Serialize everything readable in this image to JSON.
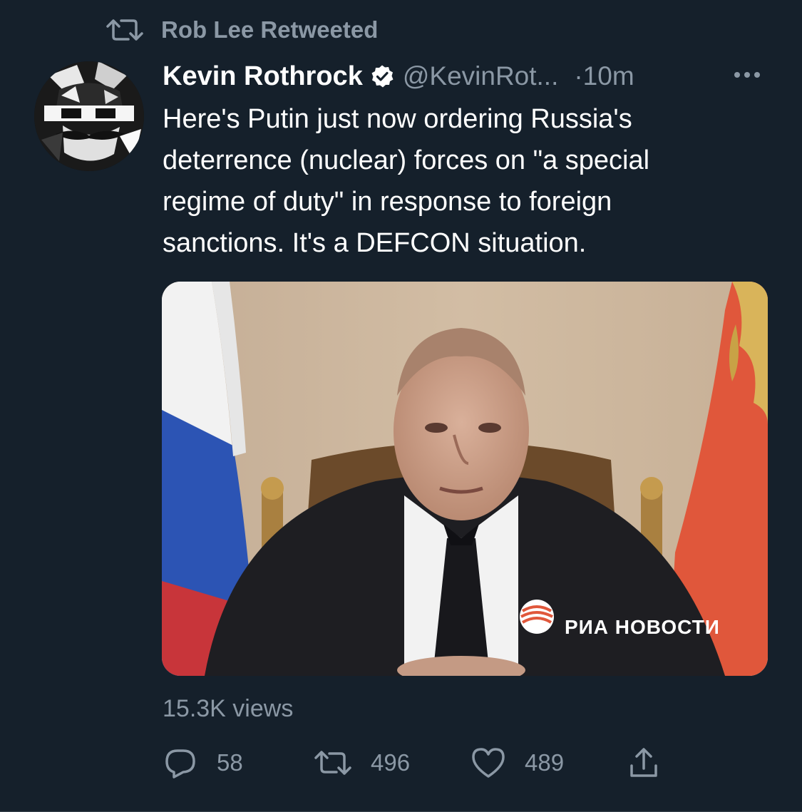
{
  "context": {
    "retweeted_by": "Rob Lee Retweeted",
    "icon": "retweet-icon"
  },
  "author": {
    "display_name": "Kevin Rothrock",
    "handle": "@KevinRot...",
    "time": "·10m",
    "verified": true
  },
  "tweet": {
    "lines": [
      "Here's Putin just now ordering Russia's",
      "deterrence (nuclear) forces on \"a special",
      "regime of duty\" in response to foreign",
      "sanctions. It's a DEFCON situation."
    ]
  },
  "media": {
    "watermark": "РИА НОВОСТИ"
  },
  "stats": {
    "views": "15.3K views"
  },
  "actions": {
    "replies": "58",
    "retweets": "496",
    "likes": "489"
  },
  "colors": {
    "background": "#15202b",
    "secondary_text": "#8b98a5",
    "primary_text": "#ffffff"
  }
}
